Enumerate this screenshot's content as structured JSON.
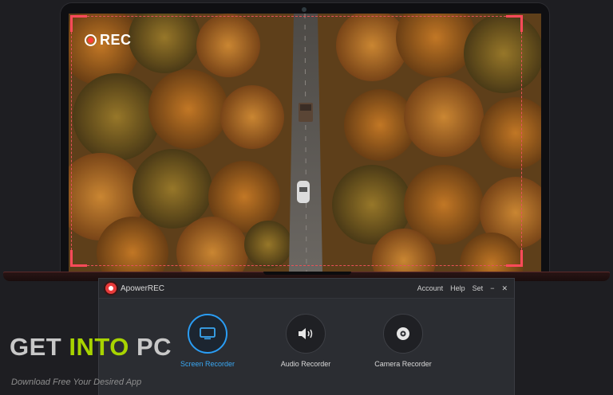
{
  "video": {
    "rec_label": "REC"
  },
  "app": {
    "name": "ApowerREC",
    "menu": [
      "Account",
      "Help",
      "Set"
    ],
    "minimize_glyph": "−",
    "close_glyph": "✕",
    "modes": [
      {
        "label": "Screen Recorder",
        "icon": "monitor-icon",
        "active": true
      },
      {
        "label": "Audio Recorder",
        "icon": "speaker-icon",
        "active": false
      },
      {
        "label": "Camera Recorder",
        "icon": "camera-icon",
        "active": false
      }
    ]
  },
  "watermark": {
    "get": "GET ",
    "into": "INTO",
    "pc": " PC",
    "tagline": "Download Free Your Desired App"
  },
  "colors": {
    "rec_red": "#ff4a5a",
    "accent_blue": "#2a9df4",
    "watermark_green": "#a8d400"
  }
}
